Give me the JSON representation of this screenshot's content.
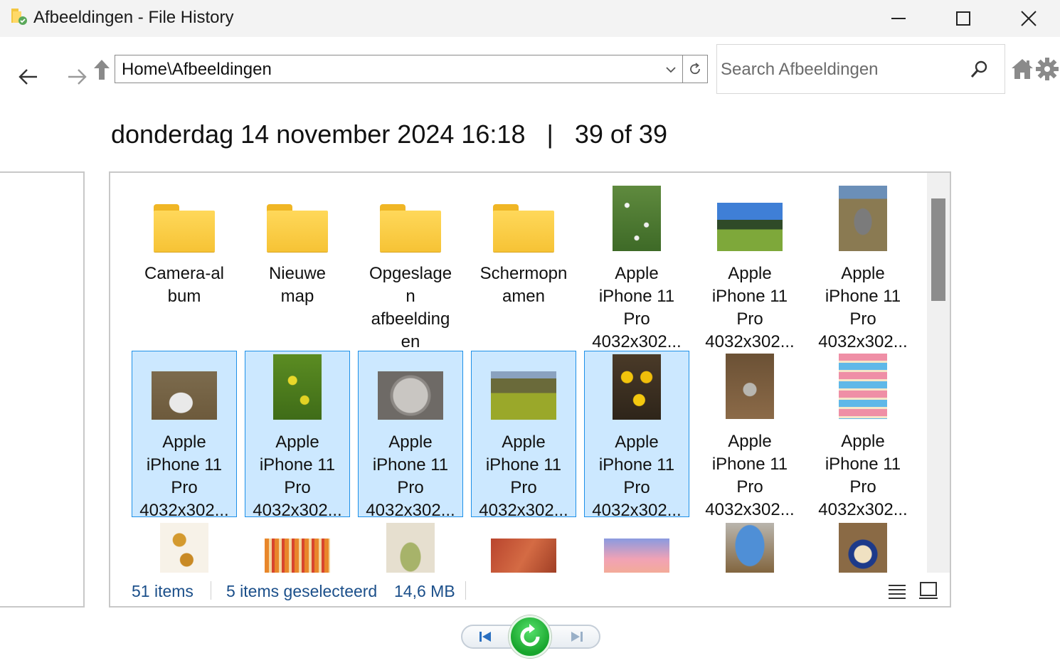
{
  "window": {
    "title": "Afbeeldingen - File History"
  },
  "toolbar": {
    "address": "Home\\Afbeeldingen",
    "search_placeholder": "Search Afbeeldingen"
  },
  "heading": {
    "date": "donderdag 14 november 2024 16:18",
    "separator": "|",
    "position": "39 of 39"
  },
  "items": [
    {
      "label": "Camera-al\nbum",
      "type": "folder",
      "selected": false
    },
    {
      "label": "Nieuwe\nmap",
      "type": "folder",
      "selected": false
    },
    {
      "label": "Opgeslage\nn\nafbeelding\nen",
      "type": "folder",
      "selected": false
    },
    {
      "label": "Schermopn\namen",
      "type": "folder",
      "selected": false
    },
    {
      "label": "Apple\niPhone 11\nPro\n4032x302...",
      "type": "photo",
      "selected": false
    },
    {
      "label": "Apple\niPhone 11\nPro\n4032x302...",
      "type": "photo",
      "selected": false
    },
    {
      "label": "Apple\niPhone 11\nPro\n4032x302...",
      "type": "photo",
      "selected": false
    },
    {
      "label": "Apple\niPhone 11\nPro\n4032x302...",
      "type": "photo",
      "selected": true
    },
    {
      "label": "Apple\niPhone 11\nPro\n4032x302...",
      "type": "photo",
      "selected": true
    },
    {
      "label": "Apple\niPhone 11\nPro\n4032x302...",
      "type": "photo",
      "selected": true
    },
    {
      "label": "Apple\niPhone 11\nPro\n4032x302...",
      "type": "photo",
      "selected": true
    },
    {
      "label": "Apple\niPhone 11\nPro\n4032x302...",
      "type": "photo",
      "selected": true
    },
    {
      "label": "Apple\niPhone 11\nPro\n4032x302...",
      "type": "photo",
      "selected": false
    },
    {
      "label": "Apple\niPhone 11\nPro\n4032x302...",
      "type": "photo",
      "selected": false
    }
  ],
  "status": {
    "item_count": "51 items",
    "selected": "5 items geselecteerd",
    "size": "14,6 MB"
  },
  "colors": {
    "selection_bg": "#cce8ff",
    "selection_border": "#1e90e8",
    "status_text": "#1b4f8a",
    "restore_green": "#17a52c",
    "folder_yellow": "#f6c335"
  }
}
